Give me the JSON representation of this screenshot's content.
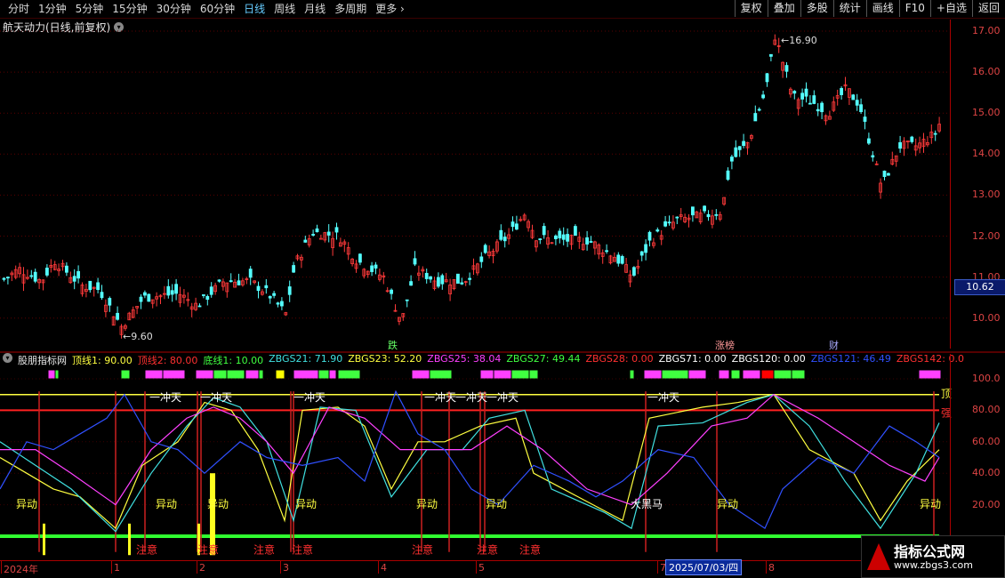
{
  "toolbar": {
    "periods": [
      "分时",
      "1分钟",
      "5分钟",
      "15分钟",
      "30分钟",
      "60分钟",
      "日线",
      "周线",
      "月线",
      "多周期",
      "更多"
    ],
    "more_icon": "chevron-right-icon",
    "actions": [
      "复权",
      "叠加",
      "多股",
      "统计",
      "画线",
      "F10",
      "+自选",
      "返回"
    ]
  },
  "stock": {
    "title": "航天动力(日线,前复权)",
    "high_label": "16.90",
    "low_label": "9.60",
    "last_price": "10.62",
    "price_ticks": [
      "17.00",
      "16.00",
      "15.00",
      "14.00",
      "13.00",
      "12.00",
      "11.00",
      "10.00"
    ],
    "markers": [
      "跌",
      "涨榜",
      "财"
    ]
  },
  "indicator": {
    "name": "股朋指标网",
    "values": [
      {
        "label": "顶线1:",
        "value": "90.00",
        "color": "#ffff40"
      },
      {
        "label": "顶线2:",
        "value": "80.00",
        "color": "#ff3030"
      },
      {
        "label": "底线1:",
        "value": "10.00",
        "color": "#40ff40"
      },
      {
        "label": "ZBGS21:",
        "value": "71.90",
        "color": "#40e0e0"
      },
      {
        "label": "ZBGS23:",
        "value": "52.20",
        "color": "#ffff40"
      },
      {
        "label": "ZBGS25:",
        "value": "38.04",
        "color": "#ff40ff"
      },
      {
        "label": "ZBGS27:",
        "value": "49.44",
        "color": "#40ff40"
      },
      {
        "label": "ZBGS28:",
        "value": "0.00",
        "color": "#ff3030"
      },
      {
        "label": "ZBGS71:",
        "value": "0.00",
        "color": "#ffffff"
      },
      {
        "label": "ZBGS120:",
        "value": "0.00",
        "color": "#ffffff"
      },
      {
        "label": "ZBGS121:",
        "value": "46.49",
        "color": "#3050ff"
      },
      {
        "label": "ZBGS142:",
        "value": "0.0",
        "color": "#ff3030"
      }
    ],
    "axis_ticks": [
      "100.0",
      "80.00",
      "60.00",
      "40.00",
      "20.00"
    ],
    "labels_chongtian": [
      "一冲天",
      "一冲天",
      "一冲天",
      "一冲天",
      "一冲天",
      "一冲天",
      "一冲天"
    ],
    "labels_yidong": [
      "异动",
      "异动",
      "异动",
      "异动",
      "异动",
      "异动",
      "异动",
      "异动"
    ],
    "labels_zhuyi": [
      "注意",
      "注意",
      "注意",
      "注意",
      "注意",
      "注意",
      "注意"
    ],
    "label_heima": "大黑马",
    "label_ding": "顶",
    "label_qiang": "强"
  },
  "dates": {
    "ticks": [
      "2024年",
      "1",
      "2",
      "3",
      "4",
      "5",
      "7",
      "8"
    ],
    "selected": "2025/07/03/四"
  },
  "logo": {
    "main": "指标公式网",
    "url": "www.zbgs3.com"
  }
}
